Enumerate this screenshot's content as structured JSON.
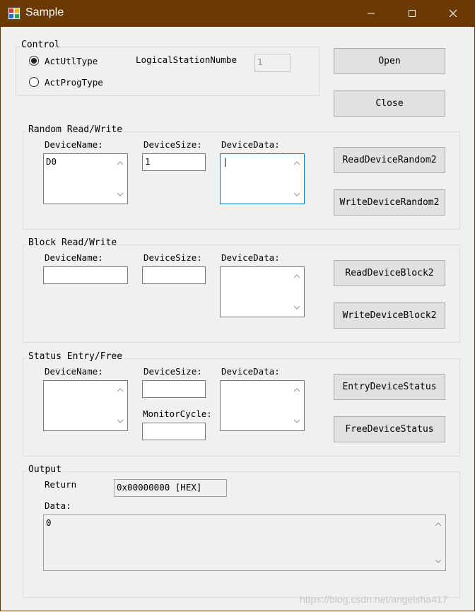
{
  "window": {
    "title": "Sample",
    "minimize_glyph": "—",
    "maximize_glyph": "☐",
    "close_glyph": "✕"
  },
  "control": {
    "label": "Control",
    "radio_utl": "ActUtlType",
    "radio_prog": "ActProgType",
    "selected": "ActUtlType",
    "logical_station_label": "LogicalStationNumbe",
    "logical_station_value": "1"
  },
  "buttons": {
    "open": "Open",
    "close": "Close",
    "read_random": "ReadDeviceRandom2",
    "write_random": "WriteDeviceRandom2",
    "read_block": "ReadDeviceBlock2",
    "write_block": "WriteDeviceBlock2",
    "entry_status": "EntryDeviceStatus",
    "free_status": "FreeDeviceStatus"
  },
  "random": {
    "label": "Random Read/Write",
    "device_name_label": "DeviceName:",
    "device_size_label": "DeviceSize:",
    "device_data_label": "DeviceData:",
    "device_name_value": "D0",
    "device_size_value": "1",
    "device_data_value": "|"
  },
  "block": {
    "label": "Block Read/Write",
    "device_name_label": "DeviceName:",
    "device_size_label": "DeviceSize:",
    "device_data_label": "DeviceData:",
    "device_name_value": "",
    "device_size_value": "",
    "device_data_value": ""
  },
  "status": {
    "label": "Status Entry/Free",
    "device_name_label": "DeviceName:",
    "device_size_label": "DeviceSize:",
    "device_data_label": "DeviceData:",
    "monitor_cycle_label": "MonitorCycle:",
    "device_name_value": "",
    "device_size_value": "",
    "device_data_value": "",
    "monitor_cycle_value": ""
  },
  "output": {
    "label": "Output",
    "return_label": "Return",
    "return_value": "0x00000000 [HEX]",
    "data_label": "Data:",
    "data_value": "0"
  },
  "watermark": "https://blog.csdn.net/angelsha417",
  "colors": {
    "titlebar": "#6b3a02",
    "focus_border": "#0078d7"
  }
}
